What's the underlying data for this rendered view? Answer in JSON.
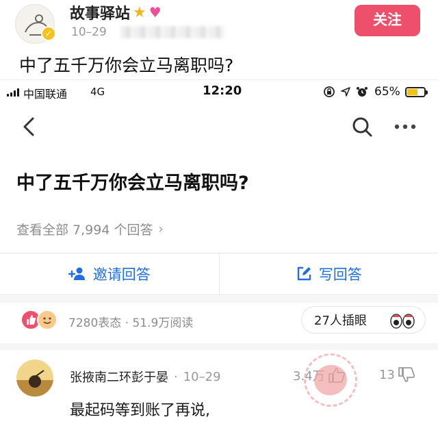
{
  "post": {
    "author": "故事驿站",
    "date": "10–29",
    "follow_label": "关注",
    "question": "中了五千万你会立马离职吗?"
  },
  "screenshot": {
    "status_bar": {
      "carrier": "中国联通",
      "network": "4G",
      "time": "12:20",
      "battery_percent": "65%",
      "battery_level": 0.65
    },
    "question_title": "中了五千万你会立马离职吗?",
    "view_all_label": "查看全部 7,994 个回答",
    "actions": {
      "invite_label": "邀请回答",
      "write_label": "写回答"
    },
    "stats_text": "7280表态 · 51.9万阅读",
    "plug_label": "27人插眼",
    "comment": {
      "name": "张掖南二环彭于晏",
      "date": "10–29",
      "likes": "3.4万",
      "dislikes": "13",
      "text": "最起码等到账了再说,"
    }
  },
  "colors": {
    "follow_button": "#ee4f6a",
    "action_blue": "#1f6fe0",
    "muted_text": "#8c8c8c",
    "battery": "#f5c400"
  }
}
